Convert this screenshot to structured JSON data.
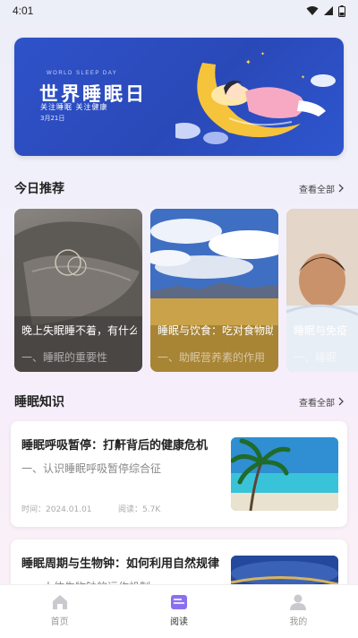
{
  "status": {
    "time": "4:01"
  },
  "banner": {
    "wsd": "WORLD SLEEP DAY",
    "title": "世界睡眠日",
    "subtitle": "关注睡眠  关注健康",
    "date": "3月21日"
  },
  "today": {
    "header": "今日推荐",
    "more": "查看全部",
    "cards": [
      {
        "title": "晚上失眠睡不着，有什么好的方法",
        "subtitle": "一、睡眠的重要性"
      },
      {
        "title": "睡眠与饮食：吃对食物助眠",
        "subtitle": "一、助眠营养素的作用"
      },
      {
        "title": "睡眠与免疫",
        "subtitle": "一、睡眠"
      }
    ]
  },
  "knowledge": {
    "header": "睡眠知识",
    "more": "查看全部",
    "articles": [
      {
        "title": "睡眠呼吸暂停：打鼾背后的健康危机",
        "subtitle": "一、认识睡眠呼吸暂停综合征",
        "time_label": "时间：2024.01.01",
        "read_label": "阅读：5.7K"
      },
      {
        "title": "睡眠周期与生物钟：如何利用自然规律",
        "subtitle": "一、人体生物钟的运作机制",
        "time_label": "",
        "read_label": ""
      }
    ]
  },
  "tabs": [
    {
      "label": "首页",
      "icon": "home-icon",
      "active": false
    },
    {
      "label": "阅读",
      "icon": "book-icon",
      "active": true
    },
    {
      "label": "我的",
      "icon": "user-icon",
      "active": false
    }
  ]
}
